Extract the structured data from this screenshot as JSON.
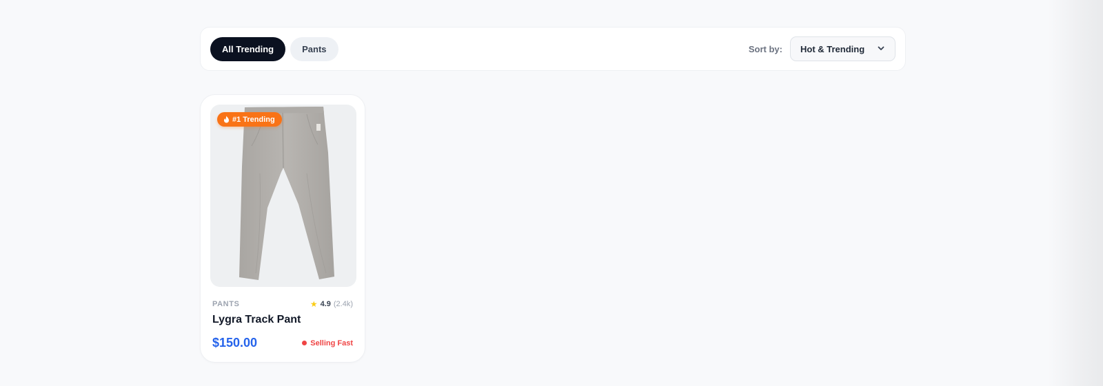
{
  "filters": {
    "chips": [
      {
        "label": "All Trending",
        "active": true
      },
      {
        "label": "Pants",
        "active": false
      }
    ],
    "sort_label": "Sort by:",
    "sort_value": "Hot & Trending"
  },
  "products": [
    {
      "badge": "#1 Trending",
      "category": "PANTS",
      "rating": "4.9",
      "rating_count": "(2.4k)",
      "title": "Lygra Track Pant",
      "price": "$150.00",
      "status": "Selling Fast",
      "image_icon": "grey-trousers-product-photo"
    }
  ],
  "colors": {
    "accent": "#0b1120",
    "price": "#2563eb",
    "badge": "#f97316",
    "status": "#ef4444",
    "star": "#facc15"
  }
}
